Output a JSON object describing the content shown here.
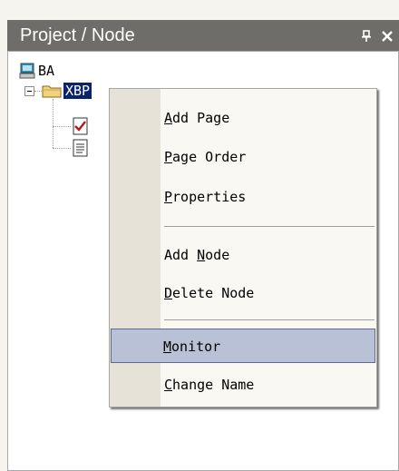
{
  "panel": {
    "title": "Project / Node",
    "pin_glyph": "ᵃ",
    "close_glyph": "×"
  },
  "tree": {
    "root_label": "BA",
    "folder_label": "XBP"
  },
  "menu": {
    "items": [
      {
        "label": "Add Page",
        "accel": "A"
      },
      {
        "label": "Page Order",
        "accel": "P"
      },
      {
        "label": "Properties",
        "accel": "P"
      },
      {
        "label": "Add Node",
        "accel": "N"
      },
      {
        "label": "Delete Node",
        "accel": "D"
      },
      {
        "label": "Monitor",
        "accel": "M",
        "highlighted": true
      },
      {
        "label": "Change Name",
        "accel": "C"
      }
    ]
  },
  "icons": [
    "pin-icon",
    "close-icon",
    "computer-icon",
    "folder-icon",
    "checkmark-page-icon",
    "document-icon"
  ],
  "colors": {
    "titlebar": "#6f6d69",
    "selection": "#0a246a",
    "menu_hover": "#b8c1d6"
  }
}
